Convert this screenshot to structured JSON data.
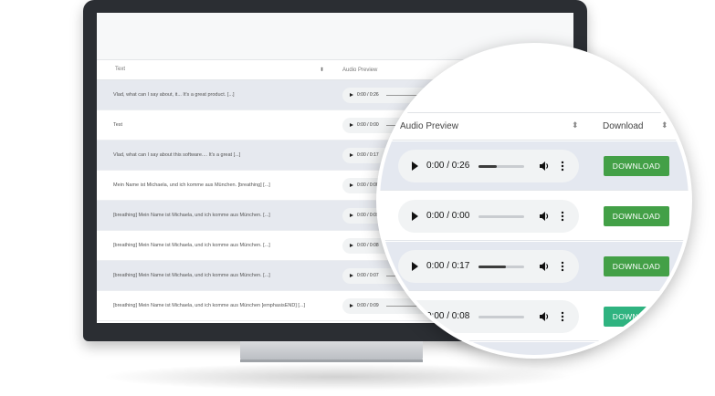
{
  "screen": {
    "columns": {
      "text": "Text",
      "audio": "Audio Preview"
    },
    "rows": [
      {
        "text": "Vlad, what can I say about, it... It's a great product. [...]",
        "time": "0:00 / 0:26"
      },
      {
        "text": "Test",
        "time": "0:00 / 0:00"
      },
      {
        "text": "Vlad, what can I say about this software.... It's a great [...]",
        "time": "0:00 / 0:17"
      },
      {
        "text": "Mein Name ist Michaela, und ich komme aus München. [breathing] [...]",
        "time": "0:00 / 0:08"
      },
      {
        "text": "[breathing] Mein Name ist Michaela, und ich komme aus München. [...]",
        "time": "0:00 / 0:09"
      },
      {
        "text": "[breathing] Mein Name ist Michaela, und ich komme aus München. [...]",
        "time": "0:00 / 0:08"
      },
      {
        "text": "[breathing] Mein Name ist Michaela, und ich komme aus München. [...]",
        "time": "0:00 / 0:07"
      },
      {
        "text": "[breathing] Mein Name ist Michaela, und ich komme aus München [emphasisEND] [...]",
        "time": "0:00 / 0:09"
      }
    ]
  },
  "zoom": {
    "columns": {
      "audio": "Audio Preview",
      "download": "Download"
    },
    "sort_glyph": "⬍",
    "download_label": "DOWNLOAD",
    "rows": [
      {
        "time": "0:00 / 0:26",
        "progress": 0.4
      },
      {
        "time": "0:00 / 0:00",
        "progress": 0
      },
      {
        "time": "0:00 / 0:17",
        "progress": 0.6
      },
      {
        "time": "0:00 / 0:08",
        "progress": 0
      }
    ]
  },
  "colors": {
    "accent_green": "#43a047",
    "teal_green": "#2fb380",
    "row_alt": "#e4e8f0",
    "bezel": "#2b2e33"
  }
}
